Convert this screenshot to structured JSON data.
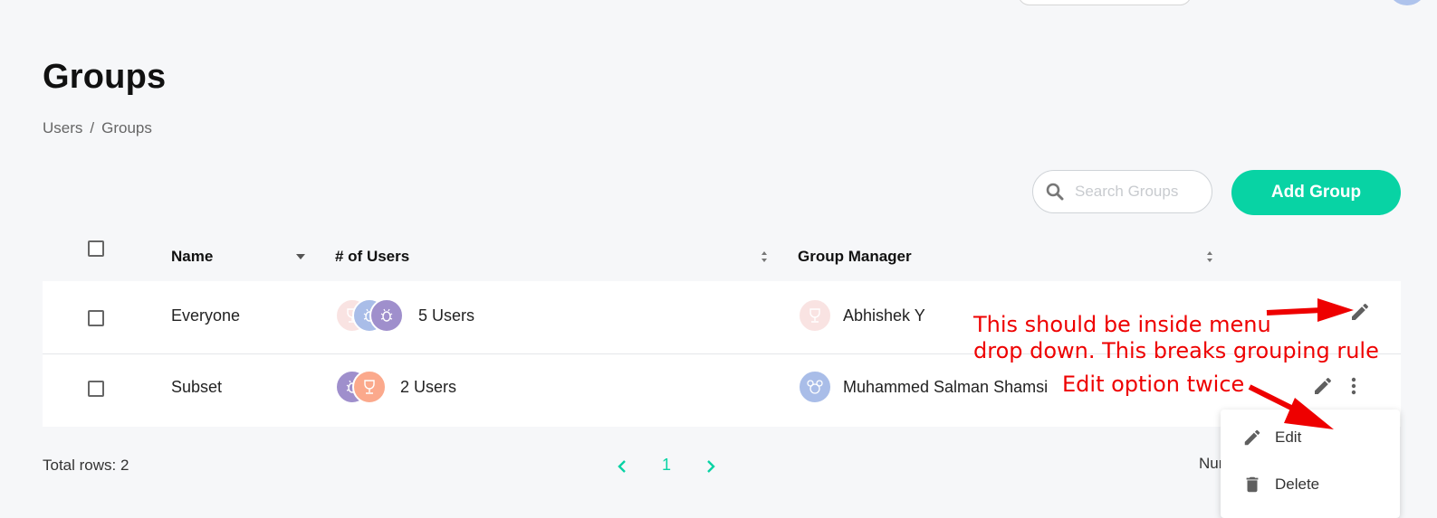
{
  "page": {
    "title": "Groups",
    "breadcrumb": [
      "Users",
      "Groups"
    ]
  },
  "toolbar": {
    "search_placeholder": "Search Groups",
    "search_value": "",
    "add_label": "Add Group"
  },
  "table": {
    "columns": [
      "Name",
      "# of Users",
      "Group Manager"
    ],
    "rows": [
      {
        "name": "Everyone",
        "users_label": "5 Users",
        "manager": "Abhishek Y",
        "user_avatars": [
          {
            "icon": "trophy-icon",
            "color": "#f9e3e2"
          },
          {
            "icon": "bug-icon",
            "color": "#a9bde8"
          },
          {
            "icon": "bug-icon",
            "color": "#9f8fcc"
          }
        ],
        "manager_avatar": {
          "icon": "trophy-icon",
          "color": "#f9e3e2"
        }
      },
      {
        "name": "Subset",
        "users_label": "2 Users",
        "manager": "Muhammed Salman Shamsi",
        "user_avatars": [
          {
            "icon": "bug-icon",
            "color": "#9f8fcc"
          },
          {
            "icon": "trophy-icon",
            "color": "#fba98c"
          }
        ],
        "manager_avatar": {
          "icon": "mouse-icon",
          "color": "#a9bde8"
        }
      }
    ]
  },
  "footer": {
    "total_rows": "Total rows: 2",
    "current_page": "1",
    "rows_per_page_label": "Num"
  },
  "menu": {
    "items": [
      {
        "label": "Edit",
        "icon": "pencil-icon"
      },
      {
        "label": "Delete",
        "icon": "trash-icon"
      }
    ]
  },
  "annotations": {
    "line1": "This should be inside menu",
    "line2": "drop down. This breaks grouping rule",
    "line3": "Edit option twice"
  },
  "colors": {
    "accent": "#08d3a4",
    "annotation": "#ee0000"
  }
}
